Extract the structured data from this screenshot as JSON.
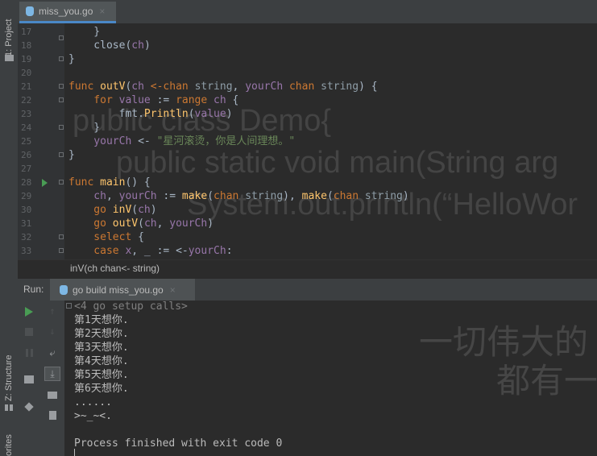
{
  "editor": {
    "tab_label": "miss_you.go",
    "tab_close": "×",
    "lines": [
      {
        "no": "17",
        "tokens": [
          {
            "t": "    }",
            "c": ""
          }
        ]
      },
      {
        "no": "18",
        "tokens": [
          {
            "t": "    close(",
            "c": ""
          },
          {
            "t": "ch",
            "c": "id"
          },
          {
            "t": ")",
            "c": ""
          }
        ]
      },
      {
        "no": "19",
        "tokens": [
          {
            "t": "}",
            "c": ""
          }
        ]
      },
      {
        "no": "20",
        "tokens": []
      },
      {
        "no": "21",
        "tokens": [
          {
            "t": "func ",
            "c": "kw"
          },
          {
            "t": "outV",
            "c": "fn"
          },
          {
            "t": "(",
            "c": ""
          },
          {
            "t": "ch ",
            "c": "id"
          },
          {
            "t": "<-chan ",
            "c": "kw"
          },
          {
            "t": "string",
            "c": "ty"
          },
          {
            "t": ", ",
            "c": ""
          },
          {
            "t": "yourCh ",
            "c": "id"
          },
          {
            "t": "chan ",
            "c": "kw"
          },
          {
            "t": "string",
            "c": "ty"
          },
          {
            "t": ") {",
            "c": ""
          }
        ]
      },
      {
        "no": "22",
        "tokens": [
          {
            "t": "    for ",
            "c": "kw"
          },
          {
            "t": "value",
            "c": "id"
          },
          {
            "t": " := ",
            "c": ""
          },
          {
            "t": "range ",
            "c": "kw"
          },
          {
            "t": "ch",
            "c": "id"
          },
          {
            "t": " {",
            "c": ""
          }
        ]
      },
      {
        "no": "23",
        "tokens": [
          {
            "t": "        fmt.",
            "c": ""
          },
          {
            "t": "Println",
            "c": "fn"
          },
          {
            "t": "(",
            "c": ""
          },
          {
            "t": "value",
            "c": "id"
          },
          {
            "t": ")",
            "c": ""
          }
        ]
      },
      {
        "no": "24",
        "tokens": [
          {
            "t": "    }",
            "c": ""
          }
        ]
      },
      {
        "no": "25",
        "tokens": [
          {
            "t": "    yourCh",
            "c": "id"
          },
          {
            "t": " <- ",
            "c": ""
          },
          {
            "t": "\"星河滚烫，你是人间理想。\"",
            "c": "str"
          }
        ]
      },
      {
        "no": "26",
        "tokens": [
          {
            "t": "}",
            "c": ""
          }
        ]
      },
      {
        "no": "27",
        "tokens": []
      },
      {
        "no": "28",
        "tokens": [
          {
            "t": "func ",
            "c": "kw"
          },
          {
            "t": "main",
            "c": "fn"
          },
          {
            "t": "() {",
            "c": ""
          }
        ]
      },
      {
        "no": "29",
        "tokens": [
          {
            "t": "    ch",
            "c": "id"
          },
          {
            "t": ", ",
            "c": ""
          },
          {
            "t": "yourCh",
            "c": "id"
          },
          {
            "t": " := ",
            "c": ""
          },
          {
            "t": "make",
            "c": "fn"
          },
          {
            "t": "(",
            "c": ""
          },
          {
            "t": "chan ",
            "c": "kw"
          },
          {
            "t": "string",
            "c": "ty"
          },
          {
            "t": "), ",
            "c": ""
          },
          {
            "t": "make",
            "c": "fn"
          },
          {
            "t": "(",
            "c": ""
          },
          {
            "t": "chan ",
            "c": "kw"
          },
          {
            "t": "string",
            "c": "ty"
          },
          {
            "t": ")",
            "c": ""
          }
        ]
      },
      {
        "no": "30",
        "tokens": [
          {
            "t": "    go ",
            "c": "kw"
          },
          {
            "t": "inV",
            "c": "fn"
          },
          {
            "t": "(",
            "c": ""
          },
          {
            "t": "ch",
            "c": "id"
          },
          {
            "t": ")",
            "c": ""
          }
        ]
      },
      {
        "no": "31",
        "tokens": [
          {
            "t": "    go ",
            "c": "kw"
          },
          {
            "t": "outV",
            "c": "fn"
          },
          {
            "t": "(",
            "c": ""
          },
          {
            "t": "ch",
            "c": "id"
          },
          {
            "t": ", ",
            "c": ""
          },
          {
            "t": "yourCh",
            "c": "id"
          },
          {
            "t": ")",
            "c": ""
          }
        ]
      },
      {
        "no": "32",
        "tokens": [
          {
            "t": "    select",
            "c": "kw"
          },
          {
            "t": " {",
            "c": ""
          }
        ]
      },
      {
        "no": "33",
        "tokens": [
          {
            "t": "    case ",
            "c": "kw"
          },
          {
            "t": "x",
            "c": "id"
          },
          {
            "t": ", _ := <-",
            "c": ""
          },
          {
            "t": "yourCh",
            "c": "id"
          },
          {
            "t": ":",
            "c": ""
          }
        ]
      }
    ],
    "watermark": [
      "public class Demo{",
      "public static void main(String arg",
      "System.out.println(“HelloWor"
    ],
    "hint": "inV(ch chan<- string)"
  },
  "left_tabs": {
    "project": "1: Project",
    "structure": "Z: Structure",
    "favorites": "orites"
  },
  "run": {
    "title": "Run:",
    "config_tab": "go build miss_you.go",
    "config_close": "×",
    "console_lines": [
      "<4 go setup calls>",
      "第1天想你.",
      "第2天想你.",
      "第3天想你.",
      "第4天想你.",
      "第5天想你.",
      "第6天想你.",
      "......",
      ">~_~<.",
      "",
      "Process finished with exit code 0"
    ],
    "watermark": [
      "一切伟大的",
      "都有一"
    ]
  },
  "colors": {
    "accent": "#4a88c7",
    "run_green": "#499c54",
    "keyword": "#cc7832",
    "function": "#ffc66d",
    "identifier": "#9876aa",
    "string": "#6a8759"
  }
}
